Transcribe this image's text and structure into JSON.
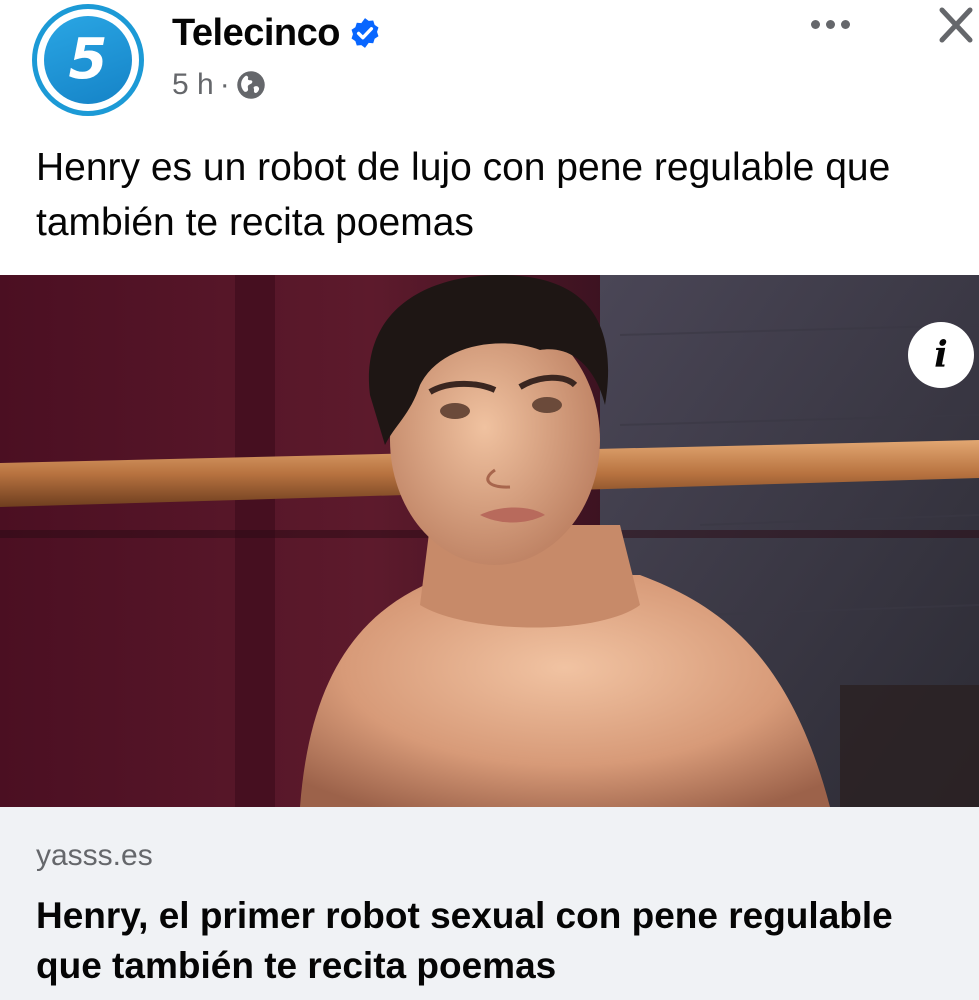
{
  "post": {
    "page_name": "Telecinco",
    "avatar_glyph": "5",
    "timestamp": "5 h",
    "separator": "·",
    "text": "Henry es un robot de lujo con pene regulable que también te recita poemas",
    "info_glyph": "i",
    "verified": true,
    "audience_icon": "globe-icon"
  },
  "link_preview": {
    "domain": "yasss.es",
    "title": "Henry, el primer robot sexual con pene regulable que también te recita poemas"
  },
  "colors": {
    "accent": "#1c9ad6",
    "verified_badge": "#0866ff",
    "secondary_text": "#65676b",
    "preview_bg": "#f0f2f5"
  }
}
